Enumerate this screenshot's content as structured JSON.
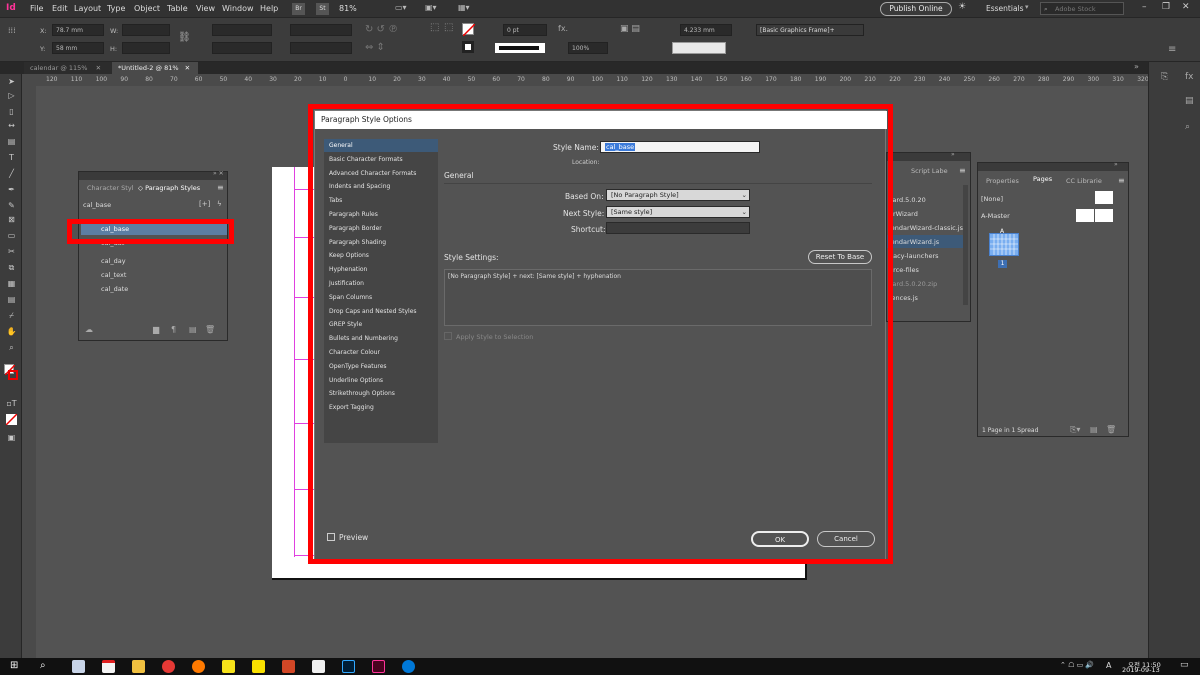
{
  "app": {
    "logo": "Id",
    "menu": [
      "File",
      "Edit",
      "Layout",
      "Type",
      "Object",
      "Table",
      "View",
      "Window",
      "Help"
    ],
    "zoom": "81%",
    "publish_label": "Publish Online",
    "workspace": "Essentials",
    "search_placeholder": "Adobe Stock",
    "x_label": "X:",
    "y_label": "Y:",
    "w_label": "W:",
    "h_label": "H:",
    "x_value": "78.7 mm",
    "y_value": "58 mm",
    "stroke_value": "0 pt",
    "opacity_value": "100%",
    "offset_value": "4.233 mm",
    "frame_style": "[Basic Graphics Frame]+",
    "icon_br": "Br",
    "icon_st": "St"
  },
  "doc_tabs": [
    "calendar @ 115%",
    "*Untitled-2 @ 81%"
  ],
  "ruler_ticks": [
    "120",
    "110",
    "100",
    "90",
    "80",
    "70",
    "60",
    "50",
    "40",
    "30",
    "20",
    "10",
    "0",
    "10",
    "20",
    "30",
    "40",
    "50",
    "60",
    "70",
    "80",
    "90",
    "100",
    "110",
    "120",
    "130",
    "140",
    "150",
    "160",
    "170",
    "180",
    "190",
    "200",
    "210",
    "220",
    "230",
    "240",
    "250",
    "260",
    "270",
    "280",
    "290",
    "300",
    "310",
    "320"
  ],
  "styles_panel": {
    "tab_character": "Character Styl",
    "tab_paragraph": "Paragraph Styles",
    "current": "cal_base",
    "items": [
      "cal_base",
      "cal_dat",
      "cal_day",
      "cal_text",
      "cal_date"
    ]
  },
  "script_panel": {
    "tab": "Script Labe",
    "items": [
      "zard.5.0.20",
      "arWizard",
      "lendarWizard-classic.js",
      "lendarWizard.js",
      "gacy-launchers",
      "urce-files",
      "zard.5.0.20.zip",
      "rences.js"
    ]
  },
  "pages_panel": {
    "tabs": [
      "Properties",
      "Pages",
      "CC Librarie"
    ],
    "none_label": "[None]",
    "master_label": "A-Master",
    "page_number": "1",
    "footer": "1 Page in 1 Spread"
  },
  "dialog": {
    "title": "Paragraph Style Options",
    "categories": [
      "General",
      "Basic Character Formats",
      "Advanced Character Formats",
      "Indents and Spacing",
      "Tabs",
      "Paragraph Rules",
      "Paragraph Border",
      "Paragraph Shading",
      "Keep Options",
      "Hyphenation",
      "Justification",
      "Span Columns",
      "Drop Caps and Nested Styles",
      "GREP Style",
      "Bullets and Numbering",
      "Character Colour",
      "OpenType Features",
      "Underline Options",
      "Strikethrough Options",
      "Export Tagging"
    ],
    "style_name_label": "Style Name:",
    "style_name_value": "cal_base",
    "location_label": "Location:",
    "section_title": "General",
    "based_on_label": "Based On:",
    "based_on_value": "[No Paragraph Style]",
    "next_style_label": "Next Style:",
    "next_style_value": "[Same style]",
    "shortcut_label": "Shortcut:",
    "style_settings_label": "Style Settings:",
    "reset_label": "Reset To Base",
    "settings_text": "[No Paragraph Style] + next: [Same style] + hyphenation",
    "apply_label": "Apply Style to Selection",
    "preview_label": "Preview",
    "ok_label": "OK",
    "cancel_label": "Cancel"
  },
  "taskbar": {
    "time": "오전 11:50",
    "date": "2019-09-13",
    "lang": "A"
  },
  "colors": {
    "highlight": "#ff0000",
    "selection": "#3d5a78",
    "brand": "#ff3399"
  }
}
